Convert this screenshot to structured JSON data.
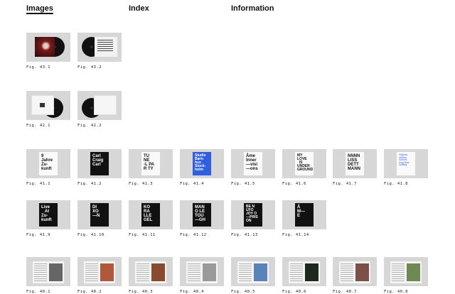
{
  "nav": {
    "images": "Images",
    "index": "Index",
    "information": "Information"
  },
  "colors": {
    "tile_bg": "#d7d7d7",
    "text": "#111111",
    "accent_blue": "#2f5fe0"
  },
  "figures": [
    {
      "id": "43.1",
      "caption": "Fig. 43.1",
      "kind": "vinyl-red"
    },
    {
      "id": "43.2",
      "caption": "Fig. 43.2",
      "kind": "vinyl-text"
    },
    {
      "id": "42.1",
      "caption": "Fig. 42.1",
      "kind": "vinyl-white"
    },
    {
      "id": "42.2",
      "caption": "Fig. 42.2",
      "kind": "vinyl-white2"
    },
    {
      "id": "41.1",
      "caption": "Fig. 41.1",
      "kind": "poster",
      "text": "9\nJahre\nZu-\nkunft",
      "style": "wht"
    },
    {
      "id": "41.2",
      "caption": "Fig. 41.2",
      "kind": "poster",
      "text": "Carl\nCraig\nCarl",
      "style": "blk"
    },
    {
      "id": "41.3",
      "caption": "Fig. 41.3",
      "kind": "poster",
      "text": "TU\nNE\n-L PA\nR TY",
      "style": "wht"
    },
    {
      "id": "41.4",
      "caption": "Fig. 41.4",
      "kind": "poster",
      "text": "Studio\nBarn-\nhus\nStock-\nholm",
      "style": "blu"
    },
    {
      "id": "41.5",
      "caption": "Fig. 41.5",
      "kind": "poster",
      "text": "Âme\nInner\n—visi\n—ons",
      "style": "wht"
    },
    {
      "id": "41.6",
      "caption": "Fig. 41.6",
      "kind": "poster",
      "text": "MY\nLOVE\n  IS\nUNDER\nGROUND",
      "style": "wht"
    },
    {
      "id": "41.7",
      "caption": "Fig. 41.7",
      "kind": "poster",
      "text": "NNNN\nLISS\nDETT\nMANN",
      "style": "wht"
    },
    {
      "id": "41.8",
      "caption": "Fig. 41.8",
      "kind": "poster",
      "text": "Objects\nHidden\nSchrott\nlong time\nlooking",
      "style": "wht-blue"
    },
    {
      "id": "41.9",
      "caption": "Fig. 41.9",
      "kind": "poster",
      "text": "Live\n   At\nZu-\nkunft",
      "style": "blk"
    },
    {
      "id": "41.10",
      "caption": "Fig. 41.10",
      "kind": "poster",
      "text": "DI\nXO\n—N",
      "style": "blk"
    },
    {
      "id": "41.11",
      "caption": "Fig. 41.11",
      "kind": "poster",
      "text": "KO\nRA\nLLE\nGEL",
      "style": "blk"
    },
    {
      "id": "41.12",
      "caption": "Fig. 41.12",
      "kind": "poster",
      "text": "MAN\nO LE\nTOU\n—GH",
      "style": "blk"
    },
    {
      "id": "41.13",
      "caption": "Fig. 41.13",
      "kind": "poster",
      "text": "BE N\nUFO\nJOY O\n—PRIS\nON",
      "style": "blk"
    },
    {
      "id": "41.14",
      "caption": "Fig. 41.14",
      "kind": "poster",
      "text": "Â\nM—\nE",
      "style": "blk"
    },
    {
      "id": "40.1",
      "caption": "Fig. 40.1",
      "kind": "spread",
      "photo": "#666666"
    },
    {
      "id": "40.2",
      "caption": "Fig. 40.2",
      "kind": "spread",
      "photo": "#b0583a"
    },
    {
      "id": "40.3",
      "caption": "Fig. 40.3",
      "kind": "spread",
      "photo": "#8a4a30"
    },
    {
      "id": "40.4",
      "caption": "Fig. 40.4",
      "kind": "spread",
      "photo": "#9a9a9a"
    },
    {
      "id": "40.5",
      "caption": "Fig. 40.5",
      "kind": "spread",
      "photo": "#5a84b8"
    },
    {
      "id": "40.6",
      "caption": "Fig. 40.6",
      "kind": "spread",
      "photo": "#1c2a1e"
    },
    {
      "id": "40.7",
      "caption": "Fig. 40.7",
      "kind": "spread",
      "photo": "#7a5048"
    },
    {
      "id": "40.8",
      "caption": "Fig. 40.8",
      "kind": "spread",
      "photo": "#6e8a52"
    }
  ]
}
